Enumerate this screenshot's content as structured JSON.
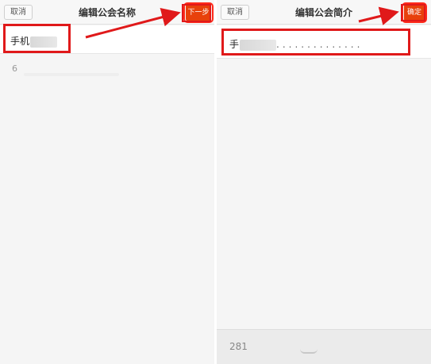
{
  "left_screen": {
    "cancel_label": "取消",
    "title": "编辑公会名称",
    "action_label": "下一步",
    "name_value": "手机",
    "char_count": "6"
  },
  "right_screen": {
    "cancel_label": "取消",
    "title": "编辑公会简介",
    "action_label": "确定",
    "intro_value": "手",
    "intro_dots": "..............",
    "remaining_count": "281"
  },
  "annotations": {
    "color": "#e0191a"
  }
}
